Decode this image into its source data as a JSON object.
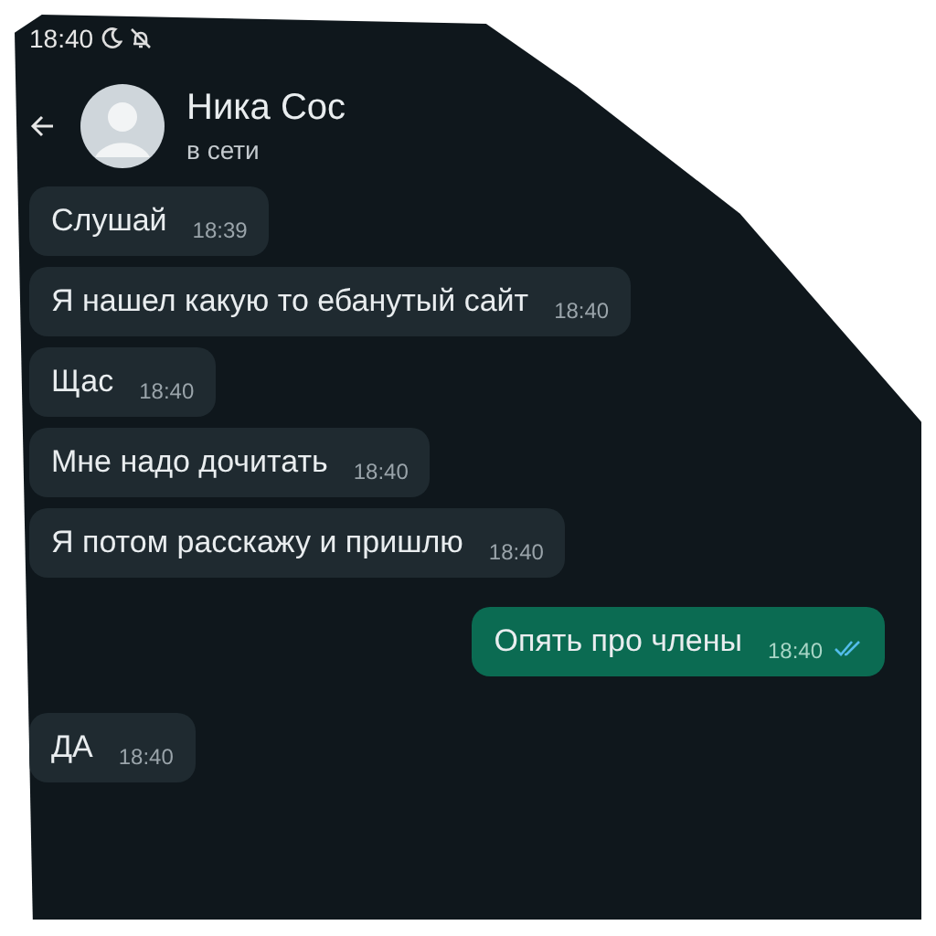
{
  "status_bar": {
    "time": "18:40"
  },
  "header": {
    "name": "Ника Сос",
    "status": "в сети"
  },
  "messages": [
    {
      "kind": "incoming",
      "text": "Слушай",
      "time": "18:39"
    },
    {
      "kind": "incoming",
      "text": "Я нашел какую то ебанутый сайт",
      "time": "18:40"
    },
    {
      "kind": "incoming",
      "text": "Щас",
      "time": "18:40"
    },
    {
      "kind": "incoming",
      "text": "Мне надо дочитать",
      "time": "18:40"
    },
    {
      "kind": "incoming",
      "text": "Я потом расскажу и пришлю",
      "time": "18:40"
    },
    {
      "kind": "outgoing",
      "text": "Опять про члены",
      "time": "18:40",
      "read": true
    },
    {
      "kind": "incoming",
      "text": "ДА",
      "time": "18:40"
    }
  ]
}
